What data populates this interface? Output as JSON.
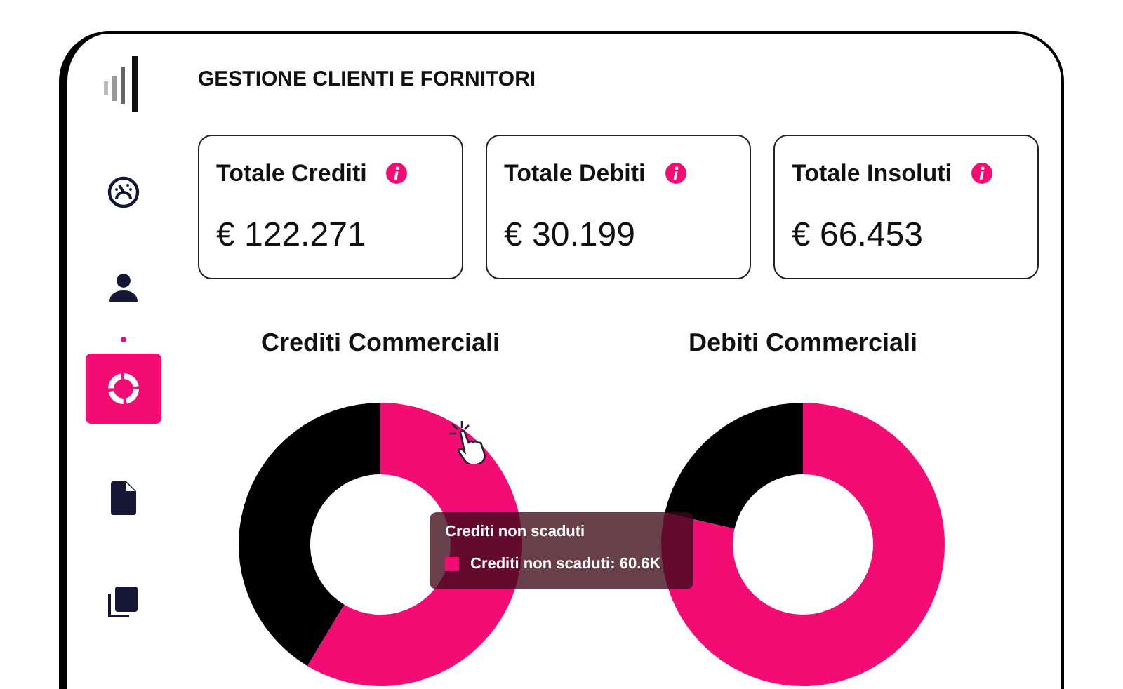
{
  "app": {
    "title": "GESTIONE CLIENTI E FORNITORI"
  },
  "sidebar": {
    "items": [
      {
        "kind": "gauge",
        "selected": false
      },
      {
        "kind": "person",
        "selected": false
      },
      {
        "kind": "donut",
        "selected": true
      },
      {
        "kind": "document",
        "selected": false
      },
      {
        "kind": "copies",
        "selected": false
      }
    ]
  },
  "cards": [
    {
      "title": "Totale Crediti",
      "value": "€ 122.271"
    },
    {
      "title": "Totale Debiti",
      "value": "€ 30.199"
    },
    {
      "title": "Totale Insoluti",
      "value": "€ 66.453"
    }
  ],
  "charts": [
    {
      "title": "Crediti Commerciali",
      "tooltip": {
        "title": "Crediti non scaduti",
        "item": "Crediti non scaduti: 60.6K"
      }
    },
    {
      "title": "Debiti Commerciali"
    }
  ]
}
